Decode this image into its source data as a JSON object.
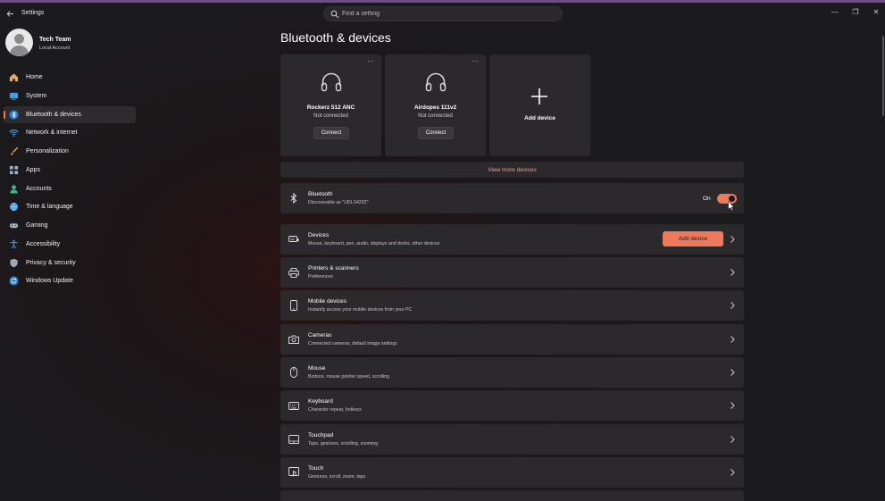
{
  "window": {
    "title": "Settings",
    "search_placeholder": "Find a setting",
    "controls": {
      "minimize": "—",
      "maximize": "❐",
      "close": "✕"
    }
  },
  "profile": {
    "name": "Tech Team",
    "account_type": "Local Account"
  },
  "sidebar": {
    "items": [
      {
        "label": "Home",
        "icon": "home-icon"
      },
      {
        "label": "System",
        "icon": "system-icon"
      },
      {
        "label": "Bluetooth & devices",
        "icon": "bluetooth-icon",
        "active": true
      },
      {
        "label": "Network & internet",
        "icon": "wifi-icon"
      },
      {
        "label": "Personalization",
        "icon": "brush-icon"
      },
      {
        "label": "Apps",
        "icon": "apps-icon"
      },
      {
        "label": "Accounts",
        "icon": "person-icon"
      },
      {
        "label": "Time & language",
        "icon": "globe-icon"
      },
      {
        "label": "Gaming",
        "icon": "gamepad-icon"
      },
      {
        "label": "Accessibility",
        "icon": "accessibility-icon"
      },
      {
        "label": "Privacy & security",
        "icon": "shield-icon"
      },
      {
        "label": "Windows Update",
        "icon": "update-icon"
      }
    ]
  },
  "page": {
    "title": "Bluetooth & devices"
  },
  "devices": [
    {
      "name": "Rockerz 512 ANC",
      "status": "Not connected",
      "button": "Connect",
      "icon": "headphones-icon",
      "more": "···"
    },
    {
      "name": "Airdopes 111v2",
      "status": "Not connected",
      "button": "Connect",
      "icon": "headphones-icon",
      "more": "···"
    }
  ],
  "add_device_card": {
    "label": "Add device"
  },
  "view_more": "View more devices",
  "bluetooth": {
    "title": "Bluetooth",
    "subtitle": "Discoverable as \"UDLS4202\"",
    "toggle_label": "On",
    "toggle_on": true
  },
  "rows": {
    "devices": {
      "title": "Devices",
      "subtitle": "Mouse, keyboard, pen, audio, displays and docks, other devices",
      "button": "Add device"
    },
    "printers": {
      "title": "Printers & scanners",
      "subtitle": "Preferences"
    },
    "mobile": {
      "title": "Mobile devices",
      "subtitle": "Instantly access your mobile devices from your PC"
    },
    "cameras": {
      "title": "Cameras",
      "subtitle": "Connected cameras, default image settings"
    },
    "mouse": {
      "title": "Mouse",
      "subtitle": "Buttons, mouse pointer speed, scrolling"
    },
    "keyboard": {
      "title": "Keyboard",
      "subtitle": "Character repeat, hotkeys"
    },
    "touchpad": {
      "title": "Touchpad",
      "subtitle": "Taps, gestures, scrolling, zooming"
    },
    "touch": {
      "title": "Touch",
      "subtitle": "Gestures, scroll, zoom, taps"
    }
  },
  "colors": {
    "accent": "#ee7a5b",
    "card": "#2b292c",
    "link": "#f0a083"
  }
}
